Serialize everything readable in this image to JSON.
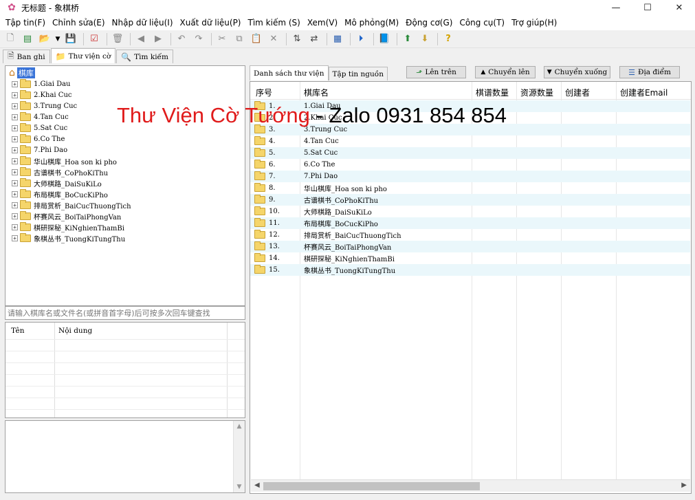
{
  "window": {
    "title": "无标题 - 象棋桥",
    "controls": [
      "minimize",
      "maximize",
      "close"
    ]
  },
  "menu": [
    "Tập tin(F)",
    "Chỉnh sửa(E)",
    "Nhập dữ liệu(I)",
    "Xuất dữ liệu(P)",
    "Tìm kiếm (S)",
    "Xem(V)",
    "Mô phỏng(M)",
    "Động cơ(G)",
    "Công cụ(T)",
    "Trợ giúp(H)"
  ],
  "toolbar_icons": [
    "new-file-icon",
    "open-database-icon",
    "open-folder-icon",
    "dropdown-arrow-icon",
    "save-icon",
    "check-document-icon",
    "delete-icon",
    "back-icon",
    "forward-icon",
    "undo-icon",
    "redo-icon",
    "cut-icon",
    "copy-icon",
    "paste-icon",
    "remove-icon",
    "sort-icon",
    "swap-icon",
    "board-icon",
    "play-icon",
    "book-icon",
    "export-icon",
    "import-icon",
    "help-icon"
  ],
  "left_tabs": [
    {
      "label": "Ban ghi",
      "icon": "document-icon"
    },
    {
      "label": "Thư viện cờ",
      "icon": "folder-icon"
    },
    {
      "label": "Tìm kiếm",
      "icon": "search-icon"
    }
  ],
  "tree": {
    "root": "棋库",
    "items": [
      "1.Giai Dau",
      "2.Khai Cuc",
      "3.Trung Cuc",
      "4.Tan Cuc",
      "5.Sat Cuc",
      "6.Co The",
      "7.Phi Dao",
      "华山棋库_Hoa son ki pho",
      "古谱棋书_CoPhoKiThu",
      "大师棋路_DaiSuKiLo",
      "布局棋库_BoCucKiPho",
      "排局赏析_BaiCucThuongTich",
      "杯赛风云_BoiTaiPhongVan",
      "棋研探秘_KiNghienThamBi",
      "象棋丛书_TuongKiTungThu"
    ]
  },
  "search": {
    "placeholder": "请输入棋库名或文件名(或拼音首字母)后可按多次回车键查找"
  },
  "props": {
    "col_name": "Tên",
    "col_content": "Nội dung"
  },
  "right_tabs": [
    "Danh sách thư viện",
    "Tập tin nguồn"
  ],
  "right_buttons": [
    {
      "label": "Lên trên",
      "icon": "up-folder-icon"
    },
    {
      "label": "Chuyển lên",
      "icon": "triangle-up-icon"
    },
    {
      "label": "Chuyển xuống",
      "icon": "triangle-down-icon"
    },
    {
      "label": "Địa điểm",
      "icon": "location-icon"
    }
  ],
  "grid": {
    "headers": [
      "序号",
      "棋库名",
      "棋谱数量",
      "资源数量",
      "创建者",
      "创建者Email"
    ],
    "rows": [
      {
        "no": "1.",
        "name": "1.Giai Dau"
      },
      {
        "no": "2.",
        "name": "2.Khai Cuc"
      },
      {
        "no": "3.",
        "name": "3.Trung Cuc"
      },
      {
        "no": "4.",
        "name": "4.Tan Cuc"
      },
      {
        "no": "5.",
        "name": "5.Sat Cuc"
      },
      {
        "no": "6.",
        "name": "6.Co The"
      },
      {
        "no": "7.",
        "name": "7.Phi Dao"
      },
      {
        "no": "8.",
        "name": "华山棋库_Hoa son ki pho"
      },
      {
        "no": "9.",
        "name": "古谱棋书_CoPhoKiThu"
      },
      {
        "no": "10.",
        "name": "大师棋路_DaiSuKiLo"
      },
      {
        "no": "11.",
        "name": "布局棋库_BoCucKiPho"
      },
      {
        "no": "12.",
        "name": "排局赏析_BaiCucThuongTich"
      },
      {
        "no": "13.",
        "name": "杯赛风云_BoiTaiPhongVan"
      },
      {
        "no": "14.",
        "name": "棋研探秘_KiNghienThamBi"
      },
      {
        "no": "15.",
        "name": "象棋丛书_TuongKiTungThu"
      }
    ]
  },
  "watermark": {
    "red": "Thư Viện Cờ Tướng",
    "black": " - Zalo 0931 854 854"
  },
  "colors": {
    "accent": "#3a74d8",
    "watermark_red": "#e01b1b",
    "row_alt": "#eaf7fb",
    "folder": "#f5d56a"
  }
}
